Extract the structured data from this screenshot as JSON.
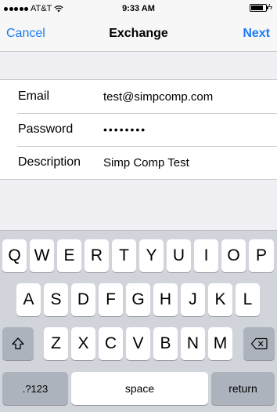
{
  "status_bar": {
    "carrier": "AT&T",
    "time": "9:33 AM",
    "battery_level": 0.85,
    "icons": [
      "signal-dots-icon",
      "wifi-icon",
      "battery-icon",
      "charging-bolt-icon"
    ],
    "bolt": "ϟ"
  },
  "nav": {
    "cancel_label": "Cancel",
    "title": "Exchange",
    "next_label": "Next",
    "accent_color": "#1a7cf6"
  },
  "form": {
    "rows": [
      {
        "label": "Email",
        "value": "test@simpcomp.com"
      },
      {
        "label": "Password",
        "value": "••••••••"
      },
      {
        "label": "Description",
        "value": "Simp Comp Test"
      }
    ]
  },
  "keyboard": {
    "row1": [
      "Q",
      "W",
      "E",
      "R",
      "T",
      "Y",
      "U",
      "I",
      "O",
      "P"
    ],
    "row2": [
      "A",
      "S",
      "D",
      "F",
      "G",
      "H",
      "J",
      "K",
      "L"
    ],
    "row3": [
      "Z",
      "X",
      "C",
      "V",
      "B",
      "N",
      "M"
    ],
    "numbers_label": ".?123",
    "space_label": "space",
    "return_label": "return",
    "shift_icon": "shift-arrow-icon",
    "delete_icon": "delete-backspace-icon"
  }
}
